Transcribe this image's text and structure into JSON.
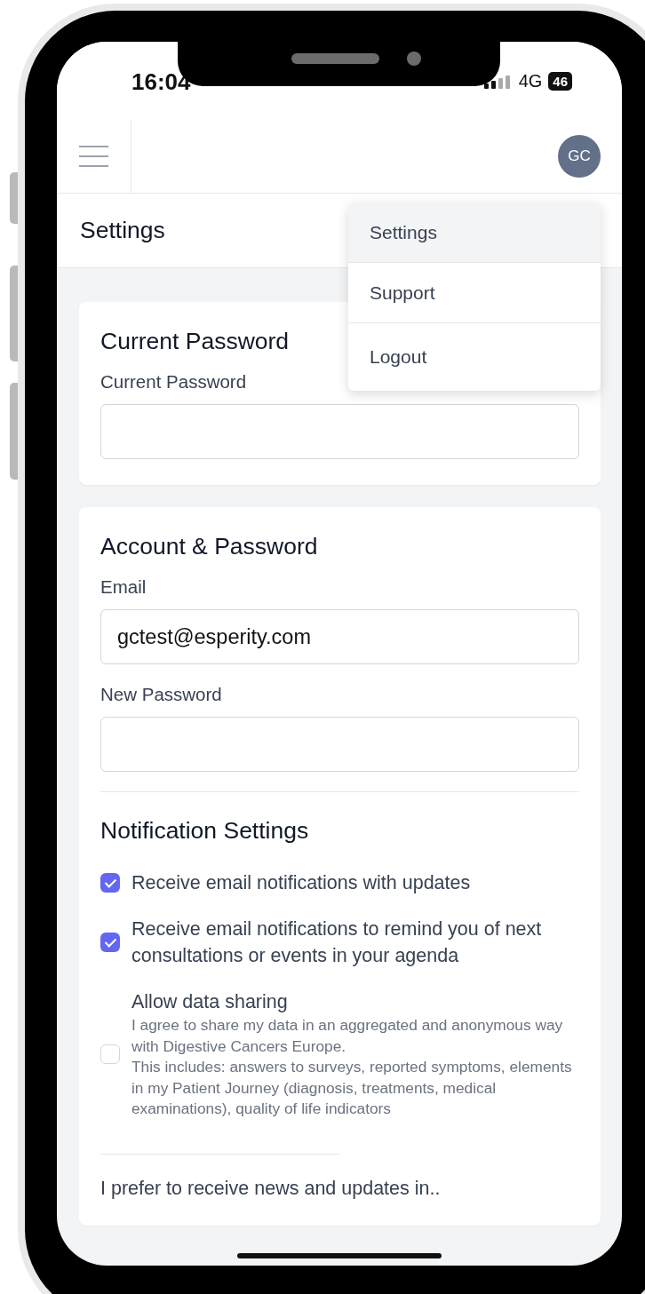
{
  "status_bar": {
    "time": "16:04",
    "network": "4G",
    "battery": "46"
  },
  "header": {
    "avatar": "GC"
  },
  "page_title": "Settings",
  "user_menu": {
    "items": [
      {
        "label": "Settings",
        "selected": true
      },
      {
        "label": "Support",
        "selected": false
      },
      {
        "label": "Logout",
        "selected": false
      }
    ]
  },
  "cards": [
    {
      "title": "Current Password",
      "fields": [
        {
          "label": "Current Password"
        }
      ]
    },
    {
      "title": "Account & Password",
      "fields": [
        {
          "label": "Email",
          "value": "gctest@esperity.com"
        },
        {
          "label": "New Password"
        }
      ],
      "notifications": {
        "title": "Notification Settings",
        "options": [
          {
            "label": "Receive email notifications with updates",
            "checked": true
          },
          {
            "label": "Receive email notifications to remind you of next consultations or events in your agenda",
            "checked": true
          },
          {
            "label": "Allow data sharing",
            "checked": false,
            "description": [
              "I agree to share my data in an aggregated and anonymous way with Digestive Cancers Europe.",
              "This includes: answers to surveys, reported symptoms, elements in my Patient Journey (diagnosis, treatments, medical examinations), quality of life indicators"
            ]
          }
        ]
      },
      "language_prompt": "I prefer to receive news and updates in.."
    }
  ]
}
